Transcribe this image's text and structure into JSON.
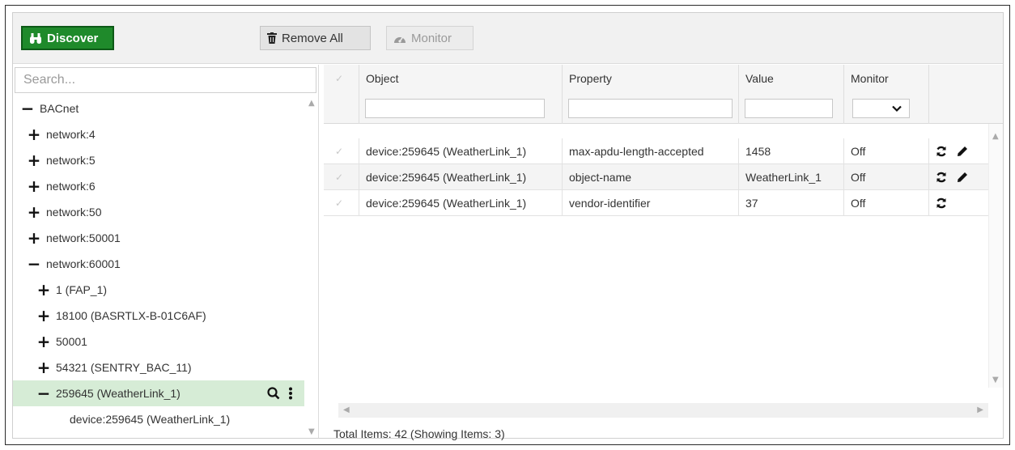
{
  "toolbar": {
    "discover_label": "Discover",
    "remove_all_label": "Remove All",
    "monitor_label": "Monitor",
    "discover_color": "#1f8a2b"
  },
  "search": {
    "placeholder": "Search..."
  },
  "tree": {
    "items": [
      {
        "label": "BACnet",
        "toggle": "−",
        "icon": "minus-icon"
      },
      {
        "label": "network:4",
        "toggle": "+",
        "icon": "plus-icon"
      },
      {
        "label": "network:5",
        "toggle": "+",
        "icon": "plus-icon"
      },
      {
        "label": "network:6",
        "toggle": "+",
        "icon": "plus-icon"
      },
      {
        "label": "network:50",
        "toggle": "+",
        "icon": "plus-icon"
      },
      {
        "label": "network:50001",
        "toggle": "+",
        "icon": "plus-icon"
      },
      {
        "label": "network:60001",
        "toggle": "−",
        "icon": "minus-icon"
      },
      {
        "label": "1 (FAP_1)",
        "toggle": "+",
        "icon": "plus-icon"
      },
      {
        "label": "18100 (BASRTLX-B-01C6AF)",
        "toggle": "+",
        "icon": "plus-icon"
      },
      {
        "label": "50001",
        "toggle": "+",
        "icon": "plus-icon"
      },
      {
        "label": "54321 (SENTRY_BAC_11)",
        "toggle": "+",
        "icon": "plus-icon"
      },
      {
        "label": "259645 (WeatherLink_1)",
        "toggle": "−",
        "icon": "minus-icon",
        "selected": true
      },
      {
        "label": "device:259645 (WeatherLink_1)",
        "toggle": "",
        "icon": ""
      }
    ],
    "selected_color": "#d6ecd6"
  },
  "grid": {
    "columns": [
      "Object",
      "Property",
      "Value",
      "Monitor"
    ],
    "rows": [
      {
        "object": "device:259645 (WeatherLink_1)",
        "property": "max-apdu-length-accepted",
        "value": "1458",
        "monitor": "Off"
      },
      {
        "object": "device:259645 (WeatherLink_1)",
        "property": "object-name",
        "value": "WeatherLink_1",
        "monitor": "Off"
      },
      {
        "object": "device:259645 (WeatherLink_1)",
        "property": "vendor-identifier",
        "value": "37",
        "monitor": "Off"
      }
    ],
    "footer": "Total Items: 42 (Showing Items: 3)"
  }
}
